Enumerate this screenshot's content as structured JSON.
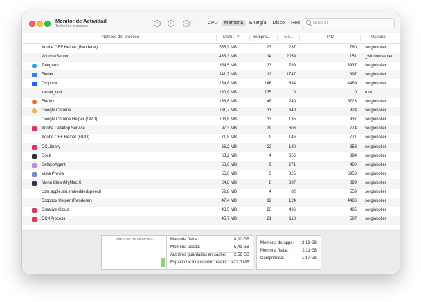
{
  "window": {
    "title": "Monitor de Actividad",
    "subtitle": "Todos los procesos"
  },
  "toolbar": {
    "icons": [
      "stop-icon",
      "info-icon",
      "more-icon"
    ],
    "tabs": [
      "CPU",
      "Memoria",
      "Energía",
      "Disco",
      "Red"
    ],
    "active_tab": "Memoria",
    "search_placeholder": "Buscar"
  },
  "table": {
    "columns": [
      "Nombre del proceso",
      "Mem... ˅",
      "Subpro...",
      "Pue...",
      "PID",
      "Usuario"
    ],
    "rows": [
      {
        "name": "Adobe CEF Helper (Renderer)",
        "mem": "555,9 MB",
        "sub": "23",
        "port": "237",
        "pid": "780",
        "user": "sergiokoller",
        "icon": "none"
      },
      {
        "name": "WindowServer",
        "mem": "433,3 MB",
        "sub": "14",
        "port": "2059",
        "pid": "151",
        "user": "_windowserver",
        "icon": "none"
      },
      {
        "name": "Telegram",
        "mem": "354,5 MB",
        "sub": "23",
        "port": "769",
        "pid": "6937",
        "user": "sergiokoller",
        "icon": "telegram"
      },
      {
        "name": "Finder",
        "mem": "341,7 MB",
        "sub": "12",
        "port": "1747",
        "pid": "397",
        "user": "sergiokoller",
        "icon": "finder"
      },
      {
        "name": "Dropbox",
        "mem": "284,8 MB",
        "sub": "146",
        "port": "634",
        "pid": "4469",
        "user": "sergiokoller",
        "icon": "dropbox"
      },
      {
        "name": "kernel_task",
        "mem": "160,9 MB",
        "sub": "175",
        "port": "0",
        "pid": "0",
        "user": "root",
        "icon": "none"
      },
      {
        "name": "Firefox",
        "mem": "138,6 MB",
        "sub": "48",
        "port": "240",
        "pid": "6723",
        "user": "sergiokoller",
        "icon": "firefox"
      },
      {
        "name": "Google Chrome",
        "mem": "131,7 MB",
        "sub": "31",
        "port": "640",
        "pid": "924",
        "user": "sergiokoller",
        "icon": "chrome"
      },
      {
        "name": "Google Chrome Helper (GPU)",
        "mem": "106,8 MB",
        "sub": "13",
        "port": "135",
        "pid": "937",
        "user": "sergiokoller",
        "icon": "none"
      },
      {
        "name": "Adobe Desktop Service",
        "mem": "97,3 MB",
        "sub": "29",
        "port": "606",
        "pid": "774",
        "user": "sergiokoller",
        "icon": "adobe-cc"
      },
      {
        "name": "Adobe CEF Helper (GPU)",
        "mem": "71,8 MB",
        "sub": "9",
        "port": "146",
        "pid": "771",
        "user": "sergiokoller",
        "icon": "none"
      },
      {
        "name": "CCLibrary",
        "mem": "66,2 MB",
        "sub": "22",
        "port": "130",
        "pid": "853",
        "user": "sergiokoller",
        "icon": "adobe-cc"
      },
      {
        "name": "Dock",
        "mem": "63,2 MB",
        "sub": "4",
        "port": "656",
        "pid": "394",
        "user": "sergiokoller",
        "icon": "dock"
      },
      {
        "name": "SetappAgent",
        "mem": "56,6 MB",
        "sub": "9",
        "port": "271",
        "pid": "480",
        "user": "sergiokoller",
        "icon": "setapp"
      },
      {
        "name": "Vista Previa",
        "mem": "55,0 MB",
        "sub": "3",
        "port": "325",
        "pid": "6958",
        "user": "sergiokoller",
        "icon": "preview"
      },
      {
        "name": "Menú CleanMyMac X",
        "mem": "54,8 MB",
        "sub": "8",
        "port": "337",
        "pid": "899",
        "user": "sergiokoller",
        "icon": "cleanmymac"
      },
      {
        "name": "com.apple.siri.embeddedspeech",
        "mem": "52,8 MB",
        "sub": "4",
        "port": "82",
        "pid": "559",
        "user": "sergiokoller",
        "icon": "none"
      },
      {
        "name": "Dropbox Helper (Renderer)",
        "mem": "47,4 MB",
        "sub": "12",
        "port": "124",
        "pid": "4486",
        "user": "sergiokoller",
        "icon": "none"
      },
      {
        "name": "Creative Cloud",
        "mem": "46,5 MB",
        "sub": "23",
        "port": "436",
        "pid": "485",
        "user": "sergiokoller",
        "icon": "adobe-cc"
      },
      {
        "name": "CCXProcess",
        "mem": "45,7 MB",
        "sub": "21",
        "port": "118",
        "pid": "587",
        "user": "sergiokoller",
        "icon": "adobe-cc"
      }
    ]
  },
  "footer": {
    "pressure_label": "PRESIÓN DE MEMORIA",
    "pressure_level": 0.3,
    "pressure_color": "#8fd07a",
    "memory": [
      {
        "label": "Memoria física:",
        "value": "8,00 GB"
      },
      {
        "label": "Memoria usada:",
        "value": "5,41 GB"
      },
      {
        "label": "Archivos guardados en caché:",
        "value": "2,58 GB"
      },
      {
        "label": "Espacio de intercambio usado:",
        "value": "422,0 MB"
      }
    ],
    "apps": [
      {
        "label": "Memoria de apps:",
        "value": "2,13 GB"
      },
      {
        "label": "Memoria física:",
        "value": "2,11 GB"
      },
      {
        "label": "Comprimida:",
        "value": "1,17 GB"
      }
    ]
  },
  "icon_colors": {
    "telegram": "#2aa3e0",
    "finder": "#3d7fe6",
    "dropbox": "#1d64f0",
    "firefox": "#ff6a1f",
    "chrome": "#e8b340",
    "adobe-cc": "#e0345a",
    "dock": "#333333",
    "setapp": "#c08ad9",
    "preview": "#6a8fc8",
    "cleanmymac": "#3a2a5a"
  }
}
